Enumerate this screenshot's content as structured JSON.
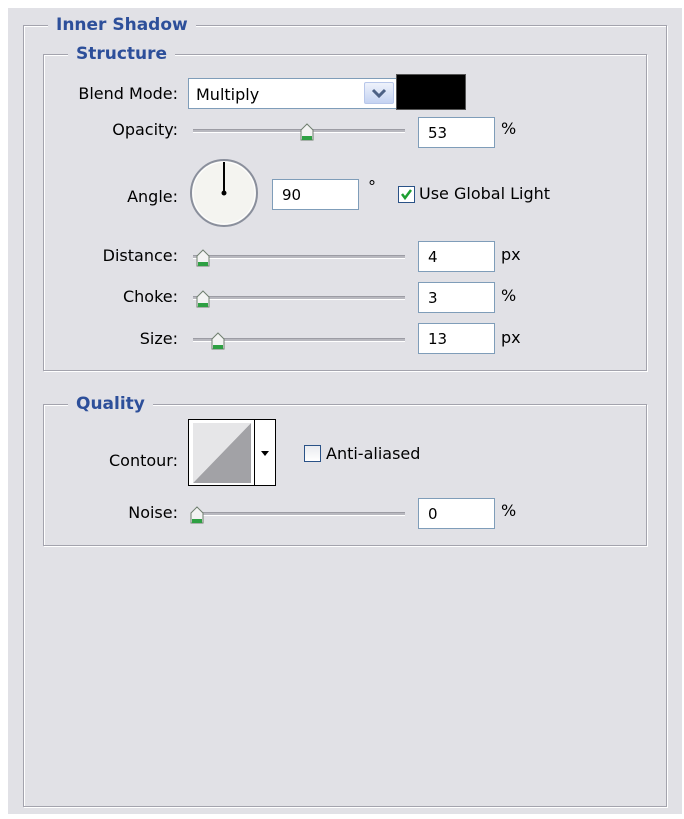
{
  "inner_shadow": {
    "title": "Inner Shadow",
    "structure": {
      "title": "Structure",
      "blend_mode": {
        "label": "Blend Mode:",
        "value": "Multiply",
        "color": "#000000"
      },
      "opacity": {
        "label": "Opacity:",
        "value": "53",
        "unit": "%",
        "slider_fraction": 0.53
      },
      "angle": {
        "label": "Angle:",
        "value": "90",
        "unit": "°",
        "use_global_light_label": "Use Global Light",
        "use_global_light_checked": true
      },
      "distance": {
        "label": "Distance:",
        "value": "4",
        "unit": "px",
        "slider_fraction": 0.0
      },
      "choke": {
        "label": "Choke:",
        "value": "3",
        "unit": "%",
        "slider_fraction": 0.0
      },
      "size": {
        "label": "Size:",
        "value": "13",
        "unit": "px",
        "slider_fraction": 0.05
      }
    },
    "quality": {
      "title": "Quality",
      "contour": {
        "label": "Contour:",
        "anti_aliased_label": "Anti-aliased",
        "anti_aliased_checked": false
      },
      "noise": {
        "label": "Noise:",
        "value": "0",
        "unit": "%",
        "slider_fraction": 0.0
      }
    }
  }
}
